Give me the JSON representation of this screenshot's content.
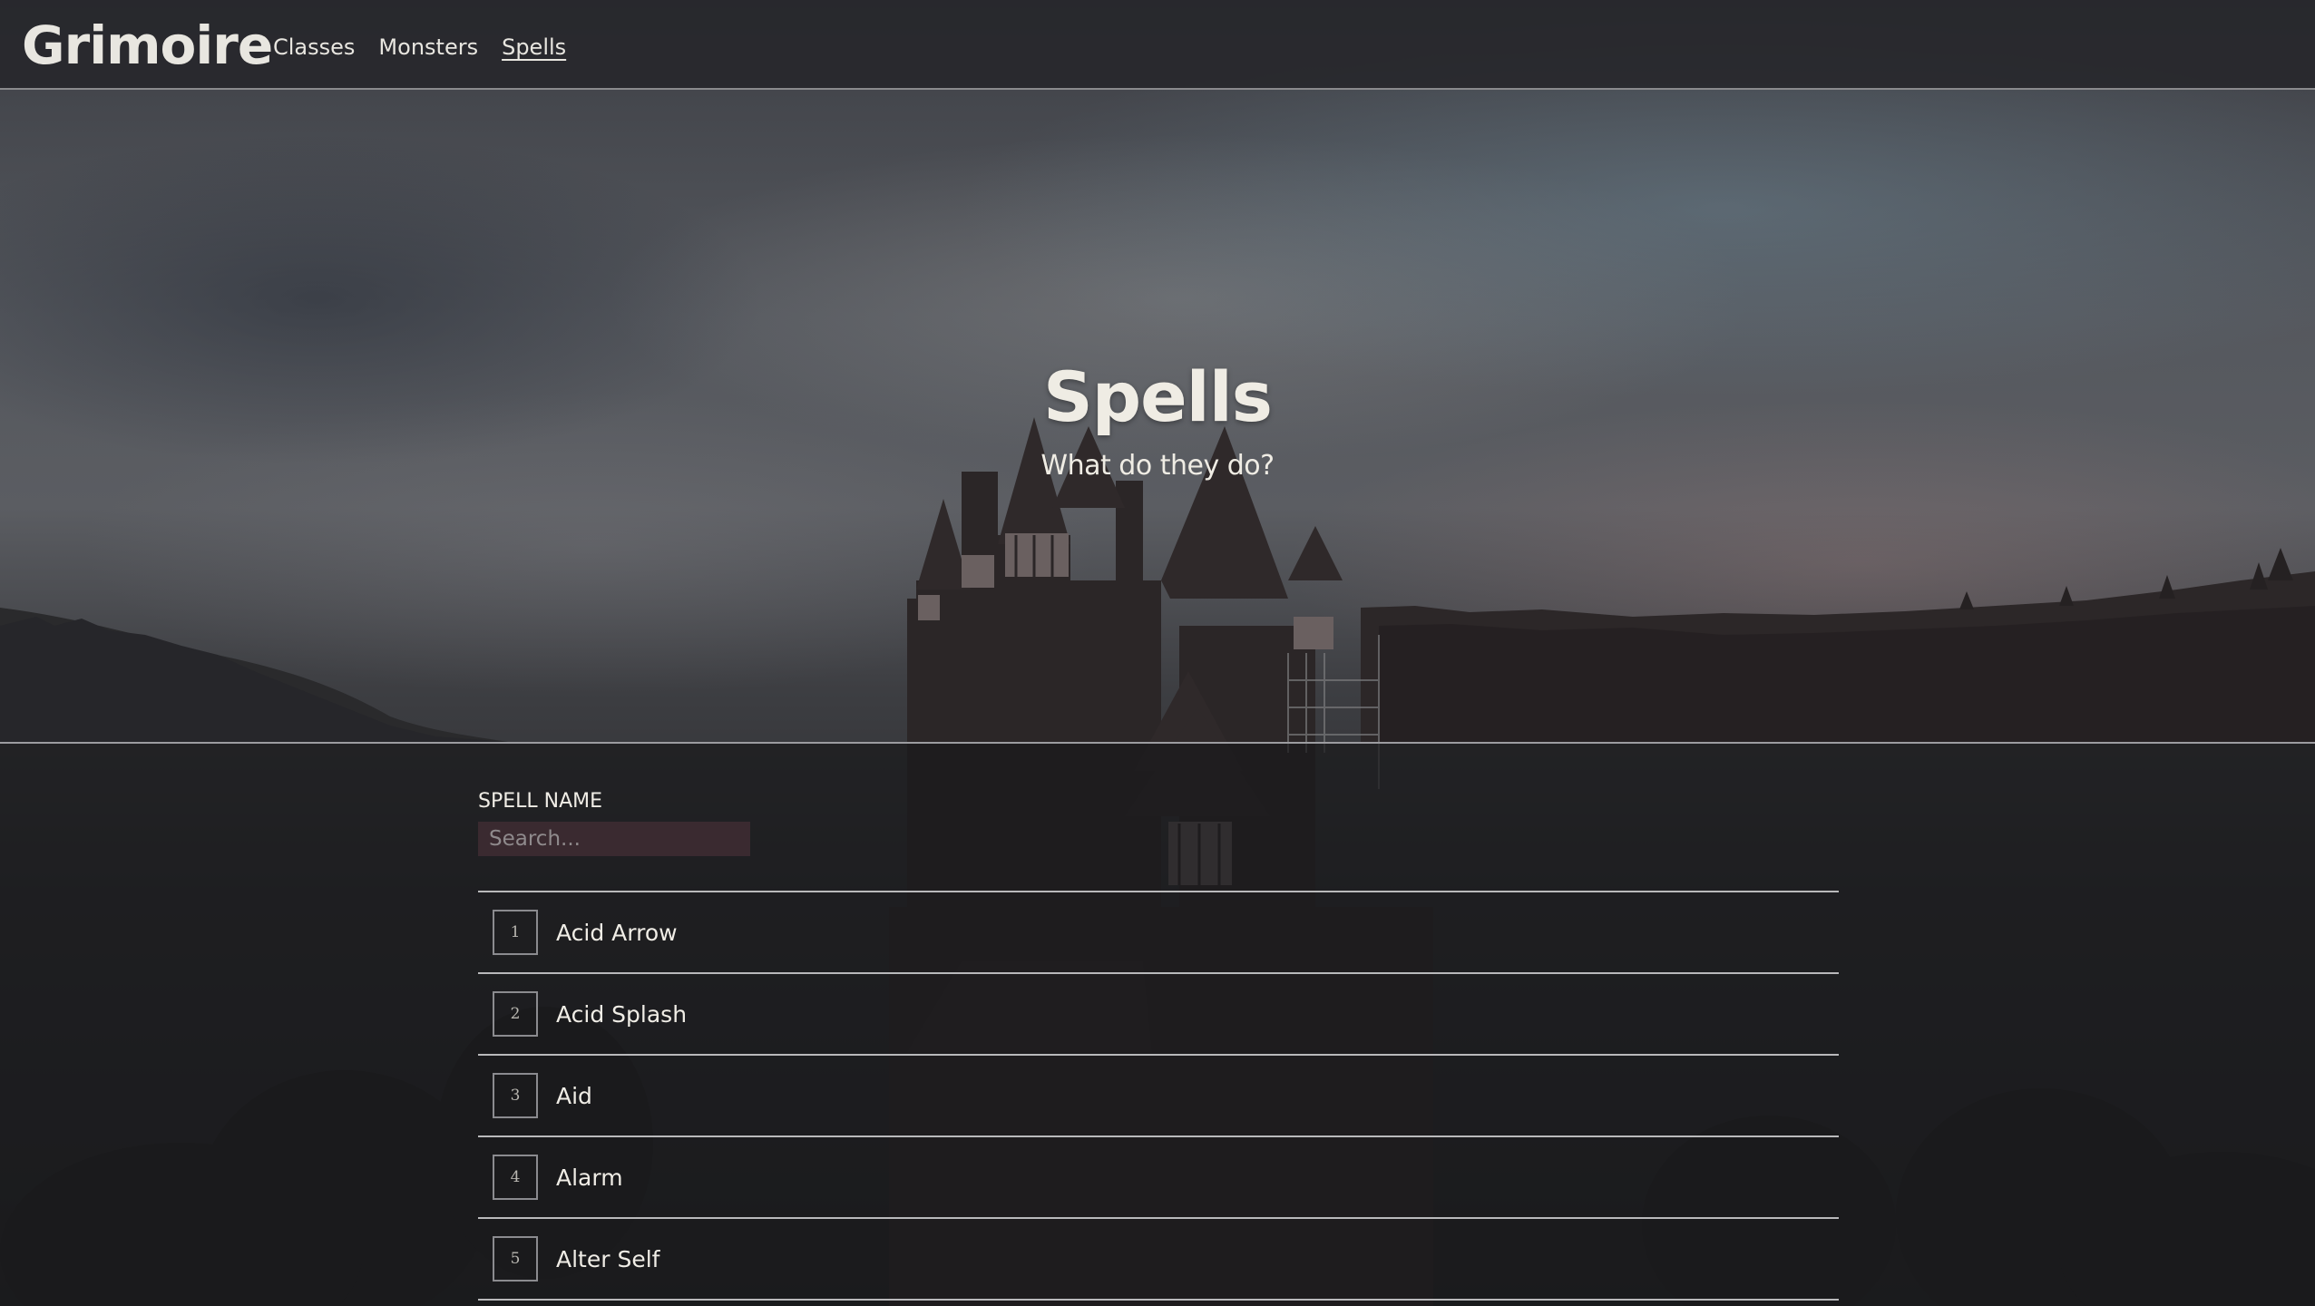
{
  "nav": {
    "logo": "Grimoire",
    "links": [
      {
        "label": "Classes",
        "active": false
      },
      {
        "label": "Monsters",
        "active": false
      },
      {
        "label": "Spells",
        "active": true
      }
    ]
  },
  "hero": {
    "title": "Spells",
    "subtitle": "What do they do?"
  },
  "search": {
    "label": "SPELL NAME",
    "placeholder": "Search...",
    "value": ""
  },
  "spells": [
    {
      "number": "1",
      "name": "Acid Arrow"
    },
    {
      "number": "2",
      "name": "Acid Splash"
    },
    {
      "number": "3",
      "name": "Aid"
    },
    {
      "number": "4",
      "name": "Alarm"
    },
    {
      "number": "5",
      "name": "Alter Self"
    }
  ],
  "colors": {
    "nav_bg": "#26262a",
    "text": "#e8e6e0",
    "search_bg": "#3a2a30",
    "divider": "#b9b9bb"
  },
  "icons": {
    "background": "castle-image"
  }
}
